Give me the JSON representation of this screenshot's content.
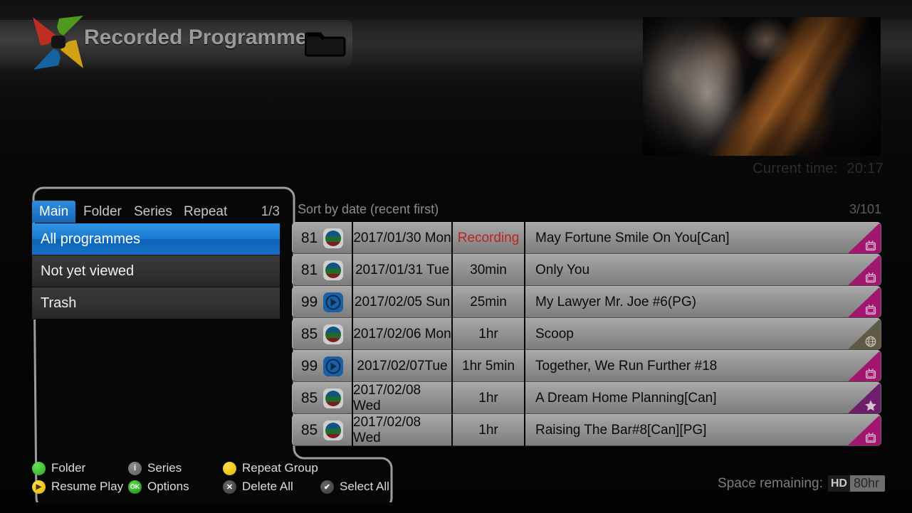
{
  "header": {
    "title": "Recorded Programmes",
    "logo_name": "pinwheel-star-logo",
    "folder_icon": "open-folder-icon",
    "logo_colors": {
      "top_left": "#c0392b",
      "top_right": "#4f9b1f",
      "bottom_left": "#1565a8",
      "bottom_right": "#d4a017"
    }
  },
  "preview": {
    "caption": "orchestra performance video preview"
  },
  "status": {
    "current_time_label": "Current time:",
    "current_time_value": "20:17",
    "space_label": "Space remaining:",
    "space_quality": "HD",
    "space_value": "80hr"
  },
  "left_panel": {
    "tabs": [
      {
        "label": "Main",
        "active": true
      },
      {
        "label": "Folder",
        "active": false
      },
      {
        "label": "Series",
        "active": false
      },
      {
        "label": "Repeat",
        "active": false
      }
    ],
    "page_indicator": "1/3",
    "categories": [
      {
        "label": "All programmes",
        "selected": true
      },
      {
        "label": "Not yet viewed",
        "selected": false
      },
      {
        "label": "Trash",
        "selected": false
      }
    ]
  },
  "legend": {
    "row1": [
      {
        "label": "Folder",
        "icon": "green-circle-icon",
        "style": "green",
        "glyph": ""
      },
      {
        "label": "Series",
        "icon": "info-circle-icon",
        "style": "grey",
        "glyph": "i"
      },
      {
        "label": "Repeat Group",
        "icon": "yellow-circle-icon",
        "style": "yellow",
        "glyph": ""
      }
    ],
    "row2": [
      {
        "label": "Resume Play",
        "icon": "play-circle-icon",
        "style": "yellow",
        "glyph": "▶"
      },
      {
        "label": "Options",
        "icon": "ok-button-icon",
        "style": "okgreen",
        "glyph": "OK"
      },
      {
        "label": "Delete All",
        "icon": "close-circle-icon",
        "style": "darkgrey",
        "glyph": "✕"
      },
      {
        "label": "Select All",
        "icon": "check-circle-icon",
        "style": "darkgrey",
        "glyph": "✔"
      }
    ]
  },
  "list": {
    "sort_label": "Sort by date (recent first)",
    "counter": "3/101",
    "rows": [
      {
        "channel": "81",
        "channel_icon": "tricolor-circle-icon",
        "date": "2017/01/30 Mon",
        "duration": "Recording",
        "recording": true,
        "title": "May Fortune Smile On You[Can]",
        "corner": "magenta",
        "corner_icon": "tv-icon"
      },
      {
        "channel": "81",
        "channel_icon": "tricolor-circle-icon",
        "date": "2017/01/31 Tue",
        "duration": "30min",
        "recording": false,
        "title": "Only You",
        "corner": "magenta",
        "corner_icon": "tv-icon"
      },
      {
        "channel": "99",
        "channel_icon": "blue-play-icon",
        "date": "2017/02/05 Sun",
        "duration": "25min",
        "recording": false,
        "title": "My Lawyer Mr. Joe #6(PG)",
        "corner": "magenta",
        "corner_icon": "tv-icon"
      },
      {
        "channel": "85",
        "channel_icon": "tricolor-circle-icon",
        "date": "2017/02/06 Mon",
        "duration": "1hr",
        "recording": false,
        "title": "Scoop",
        "corner": "olive",
        "corner_icon": "globe-icon"
      },
      {
        "channel": "99",
        "channel_icon": "blue-play-icon",
        "date": "2017/02/07Tue",
        "duration": "1hr 5min",
        "recording": false,
        "title": "Together, We Run Further #18",
        "corner": "magenta",
        "corner_icon": "tv-icon"
      },
      {
        "channel": "85",
        "channel_icon": "tricolor-circle-icon",
        "date": "2017/02/08 Wed",
        "duration": "1hr",
        "recording": false,
        "title": "A Dream Home Planning[Can]",
        "corner": "purple",
        "corner_icon": "star-icon"
      },
      {
        "channel": "85",
        "channel_icon": "tricolor-circle-icon",
        "date": "2017/02/08 Wed",
        "duration": "1hr",
        "recording": false,
        "title": "Raising The Bar#8[Can][PG]",
        "corner": "magenta",
        "corner_icon": "tv-icon"
      }
    ]
  },
  "colors": {
    "accent_blue": "#1a7ad2",
    "recording_red": "#c0231c",
    "corner_magenta": "#a1166e",
    "corner_olive": "#5f5a46",
    "corner_purple": "#6e1f6b"
  }
}
